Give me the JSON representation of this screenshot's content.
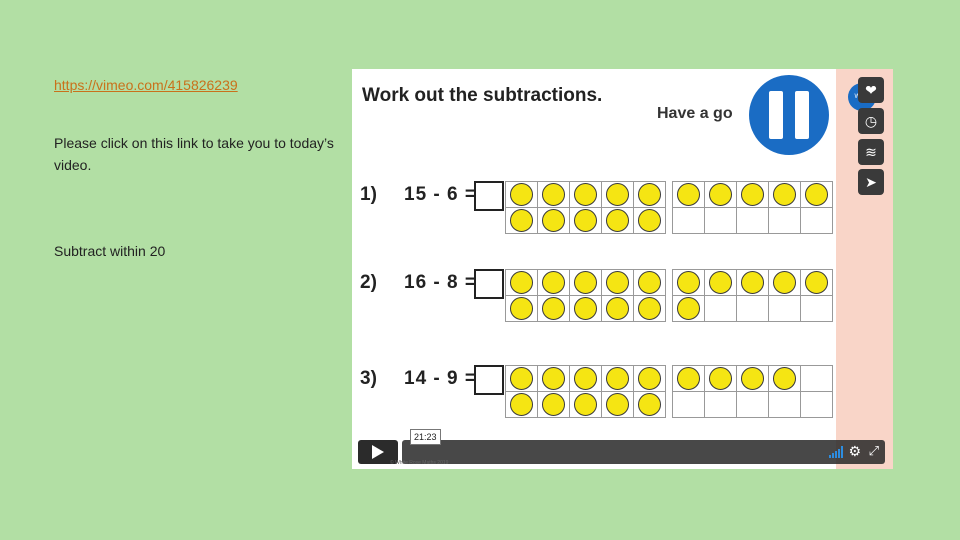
{
  "slide": {
    "link_text": "https://vimeo.com/415826239",
    "description": "Please click on this link to take you to today’s video.",
    "topic": "Subtract within 20"
  },
  "video": {
    "title": "Work out the subtractions.",
    "have_a_go": "Have a go",
    "questions": [
      {
        "num": "1)",
        "expr": "15 - 6 =",
        "counters": 15
      },
      {
        "num": "2)",
        "expr": "16 - 8 =",
        "counters": 16
      },
      {
        "num": "3)",
        "expr": "14 - 9 =",
        "counters": 14
      }
    ],
    "timestamp": "21:23",
    "copyright": "© White Rose Maths 2019",
    "logo_text": "White Rose Maths"
  },
  "icons": {
    "heart": "heart-icon",
    "clock": "clock-icon",
    "layers": "layers-icon",
    "share": "share-icon",
    "play": "play-icon",
    "volume": "volume-bars-icon",
    "settings": "gear-icon",
    "fullscreen": "fullscreen-icon"
  },
  "colors": {
    "background": "#b2dfa4",
    "link": "#c9711b",
    "pause_circle": "#1a6cc4",
    "counter": "#f5e513",
    "side_strip": "#f9d5c8"
  }
}
